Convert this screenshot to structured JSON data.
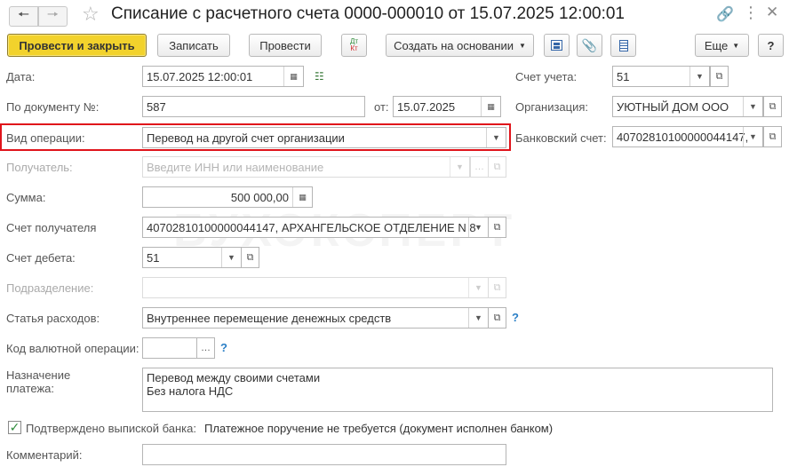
{
  "window": {
    "title": "Списание с расчетного счета 0000-000010 от 15.07.2025 12:00:01"
  },
  "watermark": "БУХЭКСПЕРТ",
  "toolbar": {
    "post_close": "Провести и закрыть",
    "save": "Записать",
    "post": "Провести",
    "dt_kt_top": "Дт",
    "dt_kt_bottom": "Кт",
    "create_based": "Создать на основании",
    "more": "Еще",
    "help": "?"
  },
  "form": {
    "date": {
      "label": "Дата:",
      "value": "15.07.2025 12:00:01"
    },
    "doc_number": {
      "label": "По документу №:",
      "value": "587"
    },
    "doc_date": {
      "label": "от:",
      "value": "15.07.2025"
    },
    "operation": {
      "label": "Вид операции:",
      "value": "Перевод на другой счет организации"
    },
    "recipient": {
      "label": "Получатель:",
      "placeholder": "Введите ИНН или наименование"
    },
    "amount": {
      "label": "Сумма:",
      "value": "500 000,00"
    },
    "recipient_account": {
      "label": "Счет получателя",
      "value": "40702810100000044147, АРХАНГЕЛЬСКОЕ ОТДЕЛЕНИЕ N 8"
    },
    "debit_account": {
      "label": "Счет дебета:",
      "value": "51"
    },
    "department": {
      "label": "Подразделение:",
      "value": ""
    },
    "expense_item": {
      "label": "Статья расходов:",
      "value": "Внутреннее перемещение денежных средств"
    },
    "currency_code": {
      "label": "Код валютной операции:",
      "value": ""
    },
    "purpose": {
      "label_line1": "Назначение",
      "label_line2": "платежа:",
      "line1": "Перевод между своими счетами",
      "line2": "Без налога НДС"
    },
    "bank_confirmed": {
      "label": "Подтверждено выпиской банка:",
      "note": "Платежное поручение не требуется (документ исполнен банком)",
      "checked": true
    },
    "comment": {
      "label": "Комментарий:",
      "value": ""
    },
    "account": {
      "label": "Счет учета:",
      "value": "51"
    },
    "organization": {
      "label": "Организация:",
      "value": "УЮТНЫЙ ДОМ ООО"
    },
    "bank_account": {
      "label": "Банковский счет:",
      "value": "40702810100000044147,"
    }
  },
  "colors": {
    "primary_button": "#f2d22c",
    "highlight_border": "#e0141b",
    "help_link": "#2a7fc6",
    "check": "#2e8b3a"
  }
}
